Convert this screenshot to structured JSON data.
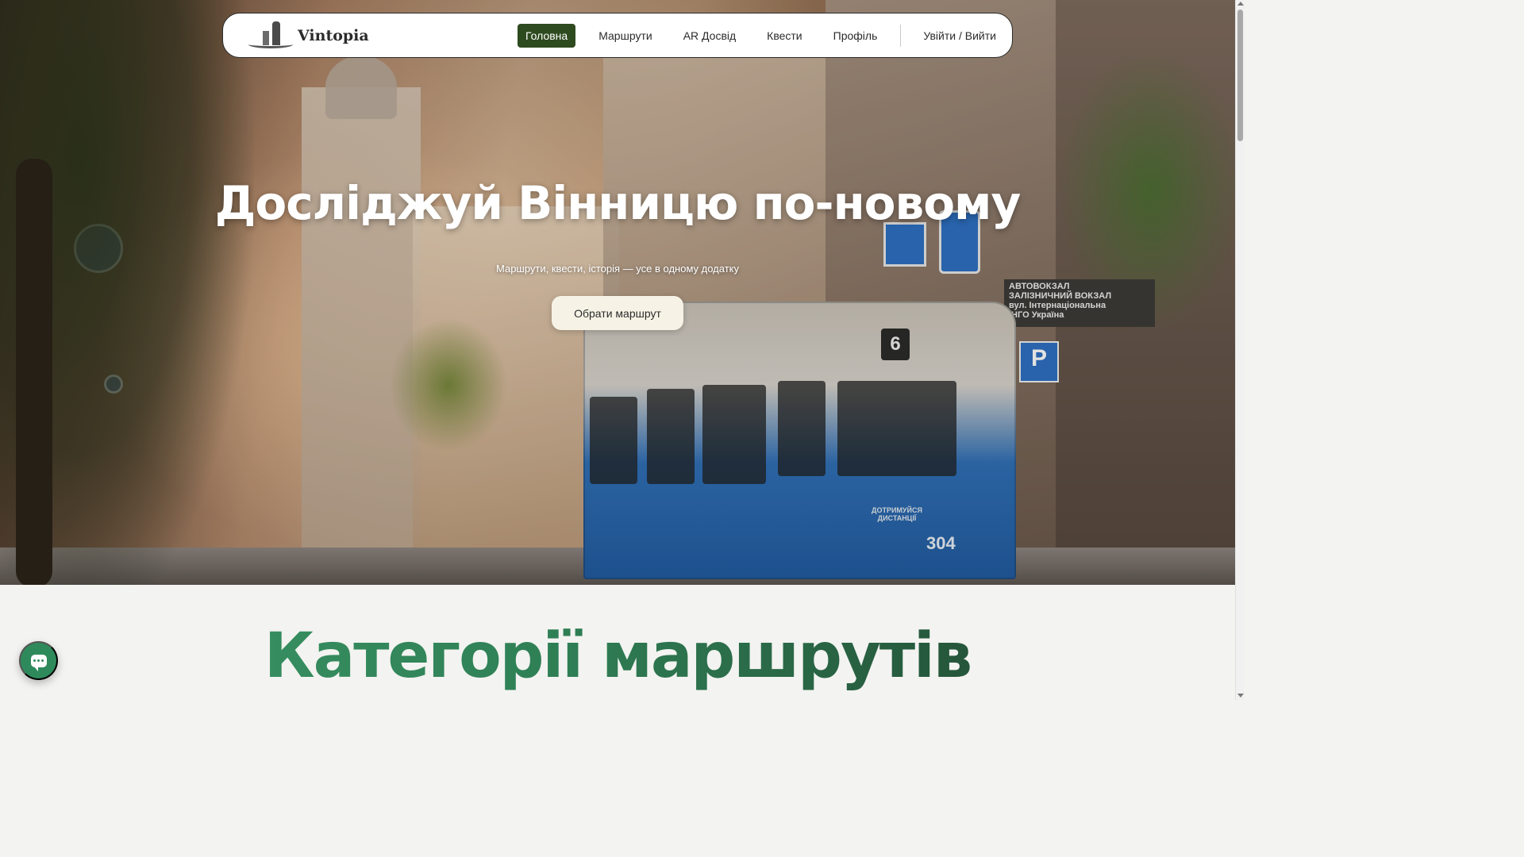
{
  "app": {
    "brand": "Vintopia",
    "colors": {
      "accent_dark_green": "#2e4a1f",
      "brand_green": "#2f8a5b",
      "cta_background": "#f6f3e6"
    }
  },
  "nav": {
    "items": [
      {
        "label": "Головна",
        "active": true
      },
      {
        "label": "Маршрути",
        "active": false
      },
      {
        "label": "AR Досвід",
        "active": false
      },
      {
        "label": "Квести",
        "active": false
      },
      {
        "label": "Профіль",
        "active": false
      }
    ],
    "auth_label": "Увійти / Вийти"
  },
  "hero": {
    "title": "Досліджуй Вінницю по-новому",
    "subtitle": "Маршрути, квести, історія — усе в одному додатку",
    "cta_label": "Обрати маршрут",
    "photo": {
      "tram_route_number": "6",
      "tram_fleet_number": "304",
      "tram_notice": "ДОТРИМУЙСЯ ДИСТАНЦІЇ",
      "station_sign_lines": [
        "АВТОВОКЗАЛ",
        "ЗАЛІЗНИЧНИЙ ВОКЗАЛ",
        "вул. Інтернаціональна",
        "ІНГО Україна"
      ],
      "parking_sign": "P"
    }
  },
  "categories": {
    "title": "Категорії маршрутів"
  },
  "chat": {
    "icon": "chat-bubble-icon"
  }
}
